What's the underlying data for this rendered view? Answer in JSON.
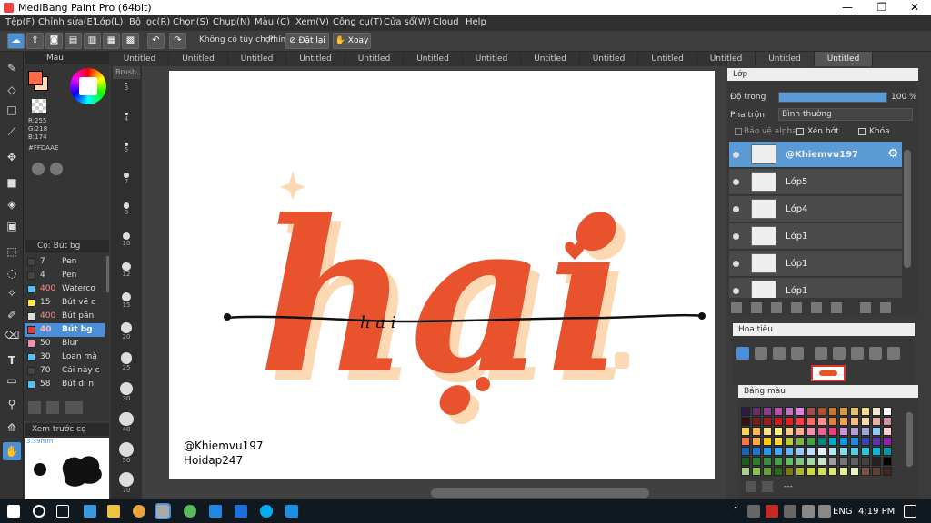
{
  "window": {
    "title": "MediBang Paint Pro (64bit)"
  },
  "menu": [
    "Tệp(F)",
    "Chỉnh sửa(E)",
    "Lớp(L)",
    "Bộ lọc(R)",
    "Chọn(S)",
    "Chụp(N)",
    "Màu (C)",
    "Xem(V)",
    "Công cụ(T)",
    "Cửa sổ(W)",
    "Cloud",
    "Help"
  ],
  "toolbar": {
    "option_label": "Không có tùy chọn",
    "key_label": "Phím",
    "reset_label": "Đặt lại",
    "rotate_label": "Xoay"
  },
  "tabs": [
    "Untitled",
    "Untitled",
    "Untitled",
    "Untitled",
    "Untitled",
    "Untitled",
    "Untitled",
    "Untitled",
    "Untitled",
    "Untitled",
    "Untitled",
    "Untitled",
    "Untitled"
  ],
  "color_panel": {
    "title": "Màu",
    "r": "R:255",
    "g": "G:218",
    "b": "B:174",
    "hex": "#FFDAAE",
    "fg_color": "#ff6b4a",
    "bg_color": "#ffdaae"
  },
  "brush_panel": {
    "title": "Cọ: Bút bg",
    "items": [
      {
        "size": "7",
        "name": "Pen",
        "color": "#444444"
      },
      {
        "size": "4",
        "name": "Pen",
        "color": "#444444"
      },
      {
        "size": "400",
        "name": "Waterco",
        "color": "#4fc3f7"
      },
      {
        "size": "15",
        "name": "Bút vẽ c",
        "color": "#ffeb3b"
      },
      {
        "size": "400",
        "name": "Bút pân",
        "color": "#dddddd"
      },
      {
        "size": "40",
        "name": "Bút bg",
        "color": "#e53935"
      },
      {
        "size": "50",
        "name": "Blur",
        "color": "#f48fb1"
      },
      {
        "size": "30",
        "name": "Loan mà",
        "color": "#4fc3f7"
      },
      {
        "size": "70",
        "name": "Cái này c",
        "color": "#444444"
      },
      {
        "size": "58",
        "name": "Bút đi n",
        "color": "#4fc3f7"
      }
    ],
    "selected_index": 5
  },
  "preview": {
    "title": "Xem trước cọ",
    "size": "3.39mm"
  },
  "brush_search": "Brush...",
  "brush_sizes": [
    "3",
    "4",
    "5",
    "7",
    "8",
    "10",
    "12",
    "15",
    "20",
    "25",
    "30",
    "40",
    "50",
    "70"
  ],
  "canvas": {
    "word": "hại",
    "script_letters": "h a i",
    "watermark_1": "@Khiemvu197",
    "watermark_2": "Hoidap247"
  },
  "layer_panel": {
    "title": "Lớp",
    "opacity_label": "Độ trong",
    "opacity_value": "100 %",
    "opacity": 1.0,
    "blend_label": "Pha trộn",
    "blend_value": "Bình thường",
    "alpha_label": "Bảo vệ alpha",
    "clip_label": "Xén bớt",
    "lock_label": "Khóa",
    "layers": [
      {
        "name": "@Khiemvu197",
        "selected": true
      },
      {
        "name": "Lớp5",
        "selected": false
      },
      {
        "name": "Lớp4",
        "selected": false
      },
      {
        "name": "Lớp1",
        "selected": false
      },
      {
        "name": "Lớp1",
        "selected": false
      },
      {
        "name": "Lớp1",
        "selected": false
      }
    ]
  },
  "navigator": {
    "title": "Hoa tiêu"
  },
  "palette": {
    "title": "Bảng màu",
    "footer": "---"
  },
  "taskbar": {
    "lang": "ENG",
    "time": "4:19 PM"
  },
  "colors": {
    "accent": "#5b9bd5",
    "letter_main": "#e8532e",
    "letter_shadow": "#fcd9b2"
  }
}
